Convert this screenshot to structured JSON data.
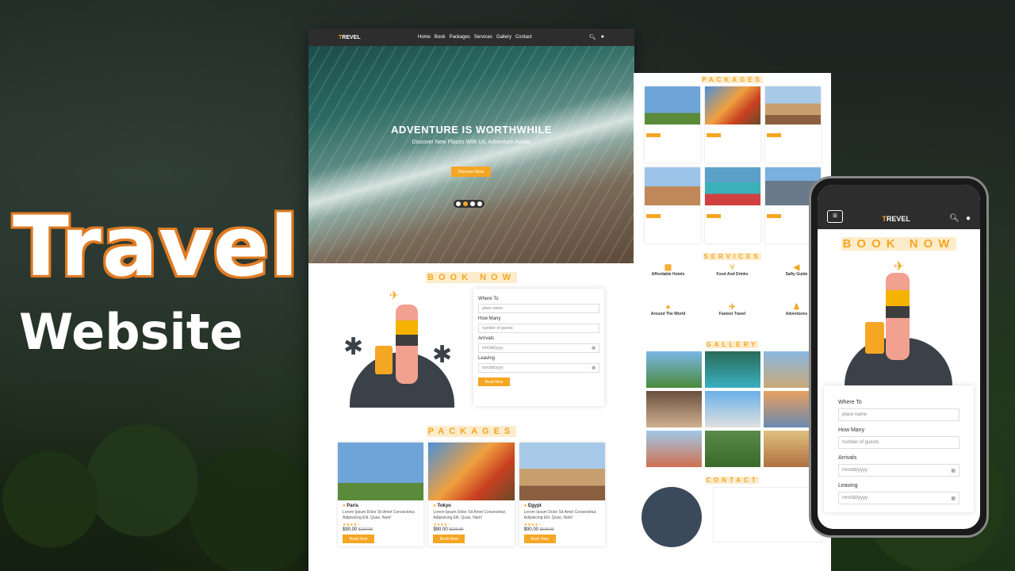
{
  "banner": {
    "title": "Travel",
    "subtitle": "Website"
  },
  "desktop": {
    "logo_first": "T",
    "logo_rest": "REVEL",
    "nav": [
      "Home",
      "Book",
      "Packages",
      "Services",
      "Gallery",
      "Contact"
    ],
    "hero": {
      "heading": "ADVENTURE IS WORTHWHILE",
      "text": "Discover New Places With Us, Adventure Awaits",
      "button": "Discover More"
    },
    "book": {
      "title": "BOOK NOW",
      "where_label": "Where To",
      "where_ph": "place name",
      "many_label": "How Many",
      "many_ph": "number of guests",
      "arr_label": "Arrivals",
      "arr_ph": "mm/dd/yyyy",
      "leave_label": "Leaving",
      "leave_ph": "mm/dd/yyyy",
      "button": "Book Now"
    },
    "packages": {
      "title": "PACKAGES",
      "items": [
        {
          "name": "Paris",
          "desc": "Lorem Ipsum Dolor Sit Amet Consectetur, Adipisicing Elit. Quas, Nam!",
          "stars": "★★★★☆",
          "price": "$90.00",
          "old": "$120.00",
          "button": "Book Now"
        },
        {
          "name": "Tokyo",
          "desc": "Lorem Ipsum Dolor Sit Amet Consectetur, Adipisicing Elit. Quas, Nam!",
          "stars": "★★★★☆",
          "price": "$90.00",
          "old": "$120.00",
          "button": "Book Now"
        },
        {
          "name": "Egypt",
          "desc": "Lorem Ipsum Dolor Sit Amet Consectetur, Adipisicing Elit. Quas, Nam!",
          "stars": "★★★★☆",
          "price": "$90.00",
          "old": "$120.00",
          "button": "Book Now"
        }
      ]
    }
  },
  "page2": {
    "packages_title": "PACKAGES",
    "services_title": "SERVICES",
    "gallery_title": "GALLERY",
    "contact_title": "CONTACT",
    "services": [
      "Affordable Hotels",
      "Food And Drinks",
      "Safty Guide",
      "Around The World",
      "Fastest Travel",
      "Adventures"
    ]
  },
  "phone": {
    "logo_first": "T",
    "logo_rest": "REVEL",
    "title": "BOOK NOW",
    "where_label": "Where To",
    "where_ph": "place name",
    "many_label": "How Many",
    "many_ph": "number of guests",
    "arr_label": "Arrivals",
    "arr_ph": "mm/dd/yyyy",
    "leave_label": "Leaving",
    "leave_ph": "mm/dd/yyyy"
  }
}
